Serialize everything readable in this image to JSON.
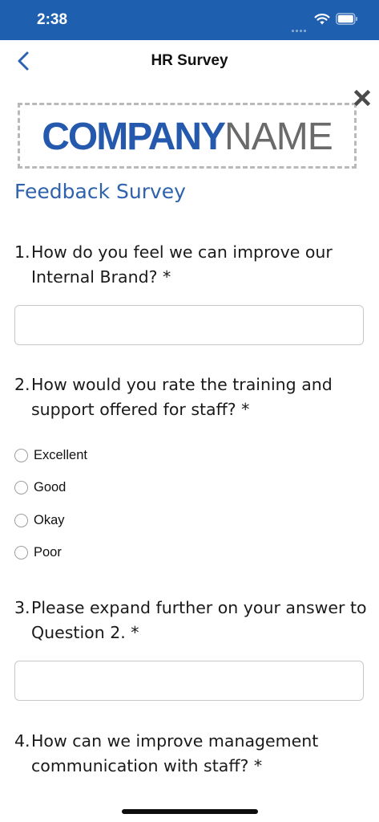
{
  "status_bar": {
    "time": "2:38",
    "background_color": "#1f5fb0",
    "icons": [
      "signal-icon",
      "wifi-icon",
      "battery-icon"
    ]
  },
  "nav": {
    "title": "HR Survey",
    "back_icon": "chevron-left-icon"
  },
  "logo": {
    "part1": "COMPANY",
    "part2": "NAME",
    "part1_color": "#2459ad",
    "part2_color": "#6a6a6a"
  },
  "survey": {
    "title": "Feedback Survey",
    "title_color": "#2e62ad",
    "questions": [
      {
        "number": "1.",
        "text": "How do you feel we can improve our Internal Brand? *",
        "type": "text",
        "value": ""
      },
      {
        "number": "2.",
        "text": "How would you rate the training and support offered for staff? *",
        "type": "radio",
        "options": [
          "Excellent",
          "Good",
          "Okay",
          "Poor"
        ],
        "selected": null
      },
      {
        "number": "3.",
        "text": "Please expand further on your answer to Question 2. *",
        "type": "text",
        "value": ""
      },
      {
        "number": "4.",
        "text": "How can we improve management communication with staff? *",
        "type": "text"
      }
    ]
  }
}
